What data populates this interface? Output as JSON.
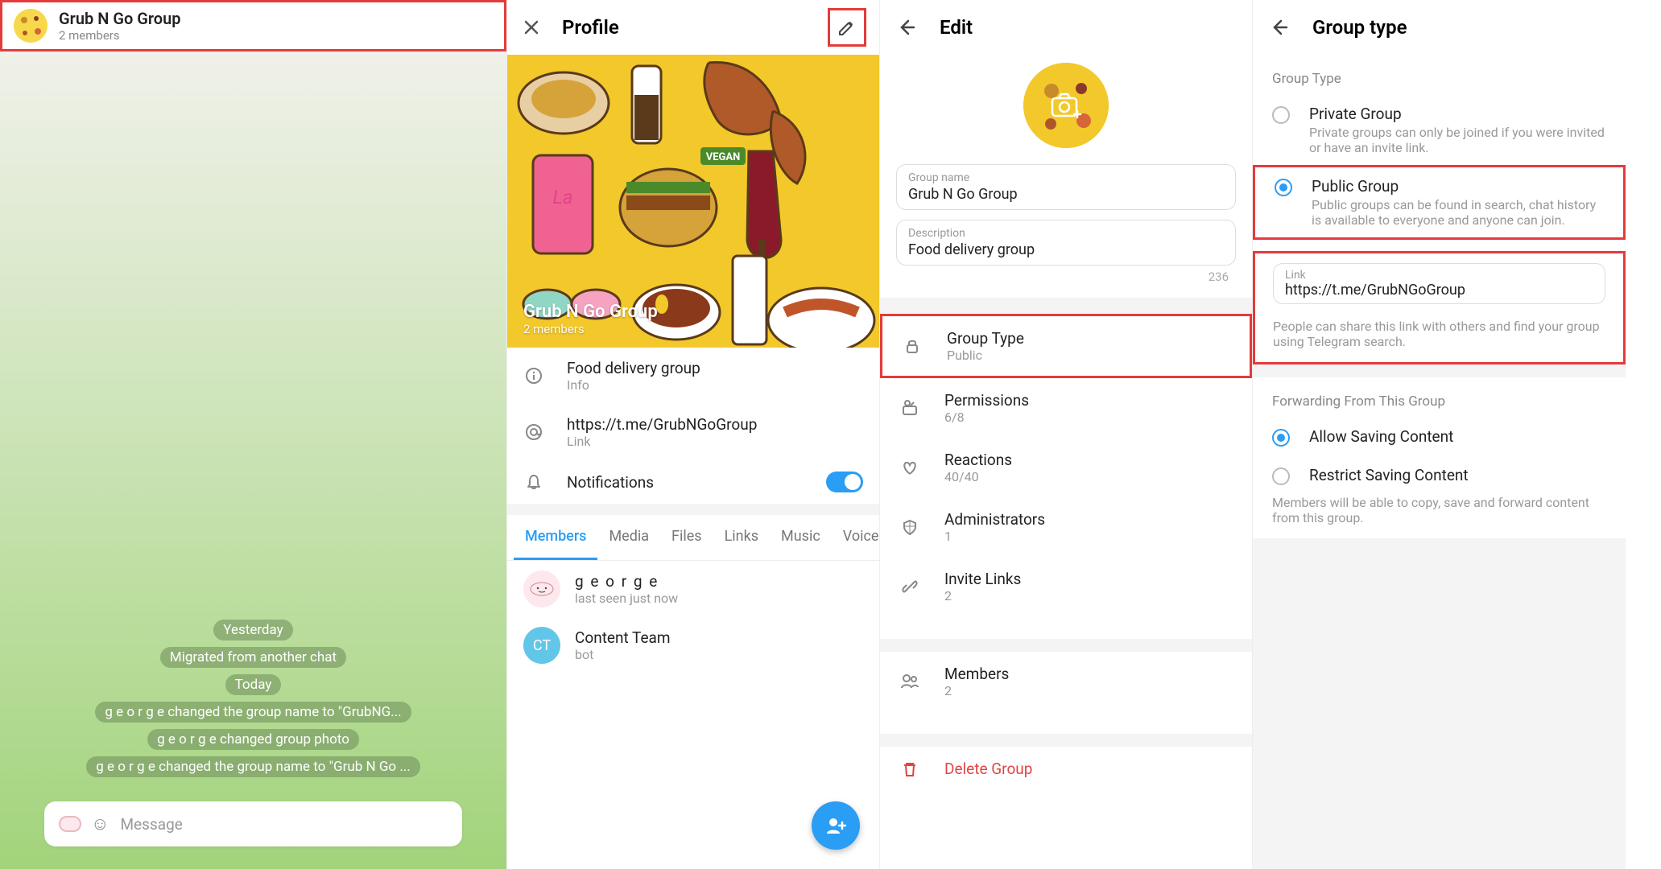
{
  "panel1": {
    "header": {
      "title": "Grub N Go Group",
      "sub": "2 members"
    },
    "badges": [
      "Yesterday",
      "Migrated from another chat",
      "Today",
      "g e o r g e  changed the group name to \"GrubNG...",
      "g e o r g e  changed group photo",
      "g e o r g e  changed the group name to \"Grub N Go ..."
    ],
    "input_placeholder": "Message"
  },
  "panel2": {
    "header_title": "Profile",
    "hero": {
      "title": "Grub N Go Group",
      "sub": "2 members"
    },
    "info": [
      {
        "l1": "Food delivery group",
        "l2": "Info"
      },
      {
        "l1": "https://t.me/GrubNGoGroup",
        "l2": "Link"
      }
    ],
    "notifications": "Notifications",
    "tabs": [
      "Members",
      "Media",
      "Files",
      "Links",
      "Music",
      "Voice"
    ],
    "members": [
      {
        "name": "g e o r g e",
        "sub": "last seen just now",
        "avatar_bg": "#fde8ed",
        "initials": ""
      },
      {
        "name": "Content Team",
        "sub": "bot",
        "avatar_bg": "#62c6e8",
        "initials": "CT"
      }
    ]
  },
  "panel3": {
    "header_title": "Edit",
    "group_name_label": "Group name",
    "group_name": "Grub N Go Group",
    "desc_label": "Description",
    "desc": "Food delivery group",
    "counter": "236",
    "rows": [
      {
        "l1": "Group Type",
        "l2": "Public",
        "hl": true,
        "icon": "lock"
      },
      {
        "l1": "Permissions",
        "l2": "6/8",
        "icon": "perm"
      },
      {
        "l1": "Reactions",
        "l2": "40/40",
        "icon": "heart"
      },
      {
        "l1": "Administrators",
        "l2": "1",
        "icon": "shield"
      },
      {
        "l1": "Invite Links",
        "l2": "2",
        "icon": "link"
      }
    ],
    "members_row": {
      "l1": "Members",
      "l2": "2"
    },
    "delete": "Delete Group"
  },
  "panel4": {
    "header_title": "Group type",
    "section1": "Group Type",
    "private": {
      "title": "Private Group",
      "desc": "Private groups can only be joined if you were invited or have an invite link."
    },
    "public": {
      "title": "Public Group",
      "desc": "Public groups can be found in search, chat history is available to everyone and anyone can join."
    },
    "link_label": "Link",
    "link": "https://t.me/GrubNGoGroup",
    "link_desc": "People can share this link with others and find your group using Telegram search.",
    "section2": "Forwarding From This Group",
    "allow": "Allow Saving Content",
    "restrict": "Restrict Saving Content",
    "restrict_desc": "Members will be able to copy, save and forward content from this group."
  }
}
